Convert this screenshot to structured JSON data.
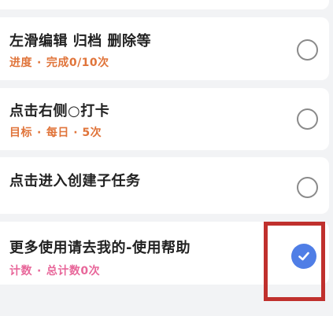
{
  "colors": {
    "background": "#f2f3f5",
    "card": "#ffffff",
    "title_text": "#222222",
    "orange_meta": "#e0743a",
    "pink_meta": "#e8679a",
    "circle_border": "#8a8a8a",
    "check_blue": "#4f7ee6",
    "highlight_red": "#c0302d"
  },
  "tasks": [
    {
      "title": "左滑编辑 归档 删除等",
      "meta_label": "进度",
      "meta_separator": "·",
      "meta_value": "完成0/10次",
      "status": "unchecked",
      "status_icon": "empty-circle-icon"
    },
    {
      "title": "点击右侧○打卡",
      "meta_label": "目标",
      "meta_separator": "·",
      "meta_value": "每日 · 5次",
      "status": "unchecked",
      "status_icon": "empty-circle-icon"
    },
    {
      "title": "点击进入创建子任务",
      "status": "unchecked",
      "status_icon": "empty-circle-icon"
    },
    {
      "title": "更多使用请去我的-使用帮助",
      "meta_label": "计数",
      "meta_separator": "·",
      "meta_value": "总计数0次",
      "status": "checked",
      "status_icon": "checkmark-circle-icon"
    }
  ]
}
